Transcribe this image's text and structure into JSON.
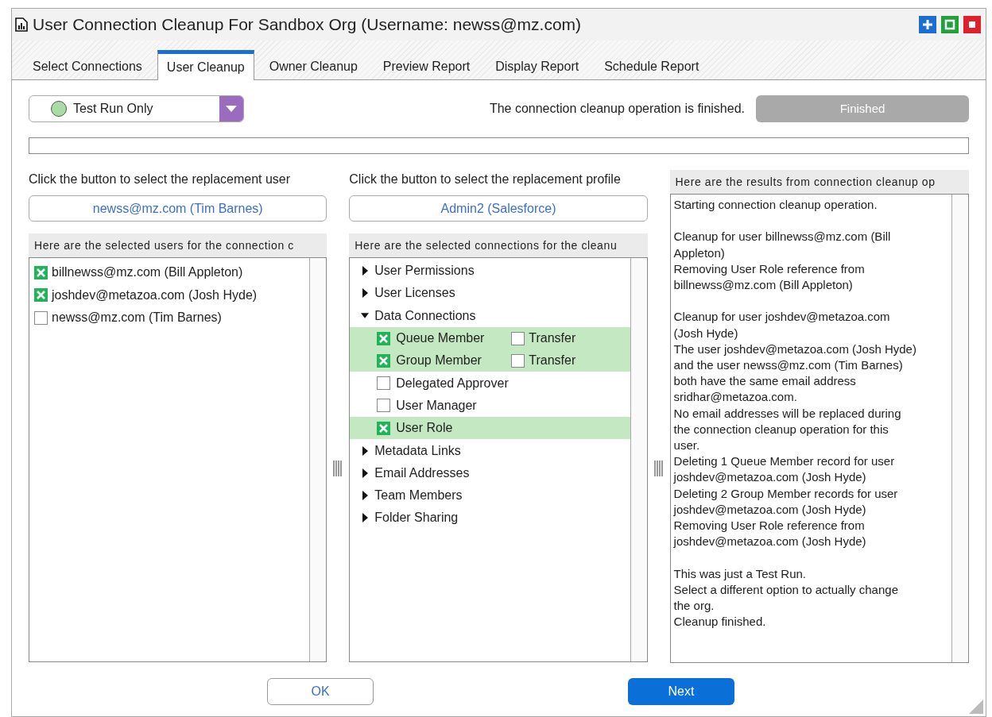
{
  "window": {
    "title": "User Connection Cleanup For Sandbox Org (Username: newss@mz.com)"
  },
  "tabs": [
    {
      "label": "Select Connections",
      "selected": false
    },
    {
      "label": "User Cleanup",
      "selected": true
    },
    {
      "label": "Owner Cleanup",
      "selected": false
    },
    {
      "label": "Preview Report",
      "selected": false
    },
    {
      "label": "Display Report",
      "selected": false
    },
    {
      "label": "Schedule Report",
      "selected": false
    }
  ],
  "mode_dropdown": {
    "value": "Test Run Only"
  },
  "status_message": "The connection cleanup operation is finished.",
  "finished_button": {
    "label": "Finished",
    "disabled": true
  },
  "progress": {
    "level": 0
  },
  "users_panel": {
    "prompt": "Click the button to select the replacement user",
    "replacement_button": "newss@mz.com (Tim Barnes)",
    "header": "Here are the selected users for the connection c",
    "items": [
      {
        "label": "billnewss@mz.com (Bill Appleton)",
        "checked": true
      },
      {
        "label": "joshdev@metazoa.com (Josh Hyde)",
        "checked": true
      },
      {
        "label": "newss@mz.com (Tim Barnes)",
        "checked": false
      }
    ]
  },
  "connections_panel": {
    "prompt": "Click the button to select the replacement profile",
    "replacement_button": "Admin2 (Salesforce)",
    "header": "Here are the selected connections for the cleanu",
    "items": [
      {
        "kind": "group",
        "label": "User Permissions",
        "expanded": false
      },
      {
        "kind": "group",
        "label": "User Licenses",
        "expanded": false
      },
      {
        "kind": "group",
        "label": "Data Connections",
        "expanded": true,
        "children": [
          {
            "kind": "check",
            "label": "Queue Member",
            "checked": true,
            "transfer": {
              "label": "Transfer",
              "checked": false
            }
          },
          {
            "kind": "check",
            "label": "Group Member",
            "checked": true,
            "transfer": {
              "label": "Transfer",
              "checked": false
            }
          },
          {
            "kind": "check",
            "label": "Delegated Approver",
            "checked": false
          },
          {
            "kind": "check",
            "label": "User Manager",
            "checked": false
          },
          {
            "kind": "check",
            "label": "User Role",
            "checked": true
          }
        ]
      },
      {
        "kind": "group",
        "label": "Metadata Links",
        "expanded": false
      },
      {
        "kind": "group",
        "label": "Email Addresses",
        "expanded": false
      },
      {
        "kind": "group",
        "label": "Team Members",
        "expanded": false
      },
      {
        "kind": "group",
        "label": "Folder Sharing",
        "expanded": false
      }
    ]
  },
  "results_panel": {
    "header": "Here are the results from connection cleanup op",
    "paragraphs": [
      [
        "Starting connection cleanup operation."
      ],
      [
        "Cleanup for user billnewss@mz.com (Bill",
        "Appleton)",
        "Removing User Role reference from",
        "billnewss@mz.com (Bill Appleton)"
      ],
      [
        "Cleanup for user joshdev@metazoa.com",
        "(Josh Hyde)",
        "The user joshdev@metazoa.com (Josh Hyde)",
        "and the user newss@mz.com (Tim Barnes)",
        "both have the same email address",
        "sridhar@metazoa.com.",
        "No email addresses will be replaced during",
        "the connection cleanup operation for this",
        "user.",
        "Deleting 1 Queue Member record for user",
        "joshdev@metazoa.com (Josh Hyde)",
        "Deleting 2 Group Member records for user",
        "joshdev@metazoa.com (Josh Hyde)",
        "Removing User Role reference from",
        "joshdev@metazoa.com (Josh Hyde)"
      ],
      [
        "This was just a Test Run.",
        "Select a different option to actually change",
        "the org.",
        "Cleanup finished."
      ]
    ]
  },
  "buttons": [
    {
      "label": "OK",
      "kind": "secondary"
    },
    {
      "label": "Next",
      "kind": "primary"
    }
  ]
}
